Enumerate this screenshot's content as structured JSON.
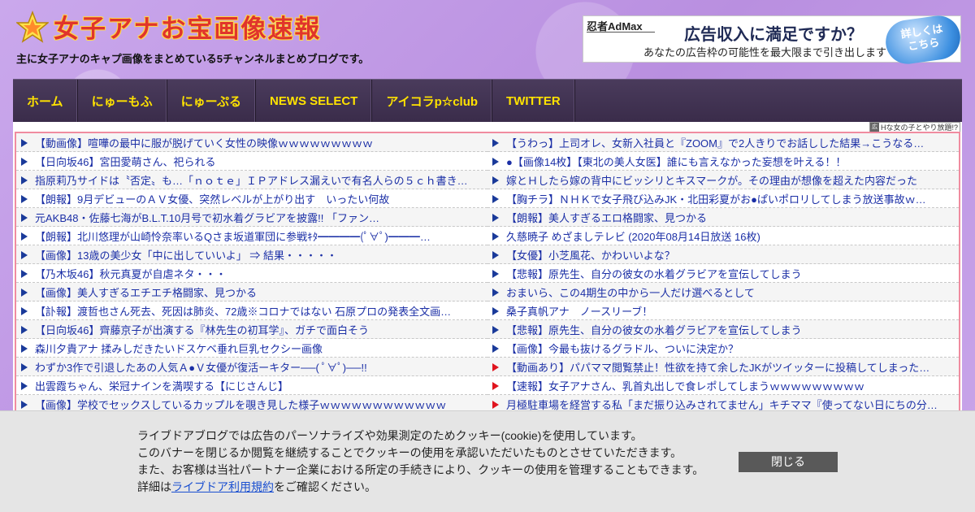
{
  "header": {
    "logo_text": "女子アナお宝画像速報",
    "tagline": "主に女子アナのキャプ画像をまとめている5チャンネルまとめブログです。"
  },
  "ad_banner": {
    "brand": "忍者AdMax",
    "headline": "広告収入に満足ですか？",
    "subtext": "あなたの広告枠の可能性を最大限まで引き出します",
    "cta_line1": "詳しくは",
    "cta_line2": "こちら"
  },
  "nav": {
    "items": [
      {
        "label": "ホーム"
      },
      {
        "label": "にゅーもふ"
      },
      {
        "label": "にゅーぷる"
      },
      {
        "label": "NEWS SELECT"
      },
      {
        "label": "アイコラp☆club"
      },
      {
        "label": "TWITTER"
      }
    ]
  },
  "ad_label": "Hな女の子とやり放題!?",
  "feed": {
    "left": [
      {
        "text": "【動画像】喧嘩の最中に服が脱げていく女性の映像ｗｗｗｗｗｗｗｗｗ",
        "arrow": "blue"
      },
      {
        "text": "【日向坂46】宮田愛萌さん、祀られる",
        "arrow": "blue"
      },
      {
        "text": "指原莉乃サイドは〝否定〟も…「ｎｏｔｅ」ＩＰアドレス漏えいで有名人らの５ｃｈ書き…",
        "arrow": "blue"
      },
      {
        "text": "【朗報】9月デビューのＡＶ女優、突然レベルが上がり出す　いったい何故",
        "arrow": "blue"
      },
      {
        "text": "元AKB48・佐藤七海がB.L.T.10月号で初水着グラビアを披露!! 「ファン…",
        "arrow": "blue"
      },
      {
        "text": "【朗報】北川悠理が山崎怜奈率いるQさま坂道軍団に参戦ｷﾀ━━━━(ﾟ∀ﾟ)━━━…",
        "arrow": "blue"
      },
      {
        "text": "【画像】13歳の美少女「中に出していいよ」 ⇒ 結果・・・・・",
        "arrow": "blue"
      },
      {
        "text": "【乃木坂46】秋元真夏が自虐ネタ・・・",
        "arrow": "blue"
      },
      {
        "text": "【画像】美人すぎるエチエチ格闘家、見つかる",
        "arrow": "blue"
      },
      {
        "text": "【訃報】渡哲也さん死去、死因は肺炎、72歳※コロナではない 石原プロの発表全文画…",
        "arrow": "blue"
      },
      {
        "text": "【日向坂46】齊藤京子が出演する『林先生の初耳学』、ガチで面白そう",
        "arrow": "blue"
      },
      {
        "text": "森川夕貴アナ 揉みしだきたいドスケベ垂れ巨乳セクシー画像",
        "arrow": "blue"
      },
      {
        "text": "わずか3作で引退したあの人気Ａ●Ｖ女優が復活ーキター──( ﾟ∀ﾟ)──!!",
        "arrow": "blue"
      },
      {
        "text": "出雲霞ちゃん、栄冠ナインを満喫する【にじさんじ】",
        "arrow": "blue"
      },
      {
        "text": "【画像】学校でセックスしているカップルを覗き見した様子ｗｗｗｗｗｗｗｗｗｗｗｗ",
        "arrow": "blue"
      }
    ],
    "right": [
      {
        "text": "【うわっ】上司オレ、女新入社員と『ZOOM』で2人きりでお話しした結果→こうなる…",
        "arrow": "blue"
      },
      {
        "text": "●【画像14枚】【東北の美人女医】誰にも言えなかった妄想を叶える！！",
        "arrow": "blue"
      },
      {
        "text": "嫁とＨしたら嫁の背中にビッシリとキスマークが。その理由が想像を超えた内容だった",
        "arrow": "blue"
      },
      {
        "text": "【胸チラ】ＮＨＫで女子飛び込みJK・北田彩夏がお●ぱいポロリしてしまう放送事故ｗ…",
        "arrow": "blue"
      },
      {
        "text": "【朗報】美人すぎるエロ格闘家、見つかる",
        "arrow": "blue"
      },
      {
        "text": "久慈暁子 めざましテレビ (2020年08月14日放送 16枚)",
        "arrow": "blue"
      },
      {
        "text": "【女優】小芝風花、かわいいよな？",
        "arrow": "blue"
      },
      {
        "text": "【悲報】原先生、自分の彼女の水着グラビアを宣伝してしまう",
        "arrow": "blue"
      },
      {
        "text": "おまいら、この4期生の中から一人だけ選べるとして",
        "arrow": "blue"
      },
      {
        "text": "桑子真帆アナ　ノースリーブ！",
        "arrow": "blue"
      },
      {
        "text": "【悲報】原先生、自分の彼女の水着グラビアを宣伝してしまう",
        "arrow": "blue"
      },
      {
        "text": "【画像】今最も抜けるグラドル、ついに決定か？",
        "arrow": "blue"
      },
      {
        "text": "【動画あり】パパママ閲覧禁止！性欲を持て余したJKがツイッターに投稿してしまった…",
        "arrow": "red"
      },
      {
        "text": "【速報】女子アナさん、乳首丸出しで食レポしてしまうｗｗｗｗｗｗｗｗｗ",
        "arrow": "red"
      },
      {
        "text": "月極駐車場を経営する私「まだ振り込みされてません」キチママ『使ってない日にちの分…",
        "arrow": "red"
      }
    ]
  },
  "cookie_banner": {
    "line1": "ライブドアブログでは広告のパーソナライズや効果測定のためクッキー(cookie)を使用しています。",
    "line2": "このバナーを閉じるか閲覧を継続することでクッキーの使用を承認いただいたものとさせていただきます。",
    "line3": "また、お客様は当社パートナー企業における所定の手続きにより、クッキーの使用を管理することもできます。",
    "line4_prefix": "詳細は",
    "line4_link": "ライブドア利用規約",
    "line4_suffix": "をご確認ください。",
    "close_label": "閉じる"
  }
}
